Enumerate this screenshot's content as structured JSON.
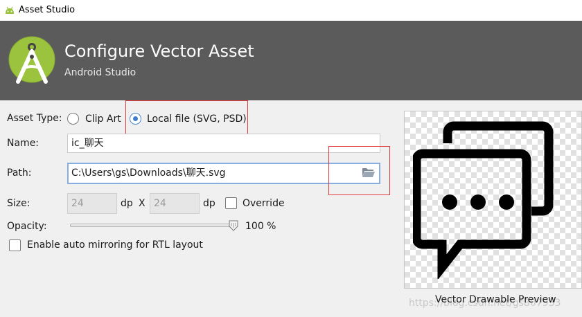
{
  "window": {
    "title": "Asset Studio"
  },
  "header": {
    "title": "Configure Vector Asset",
    "subtitle": "Android Studio"
  },
  "form": {
    "asset_type_label": "Asset Type:",
    "clip_art_label": "Clip Art",
    "local_file_label": "Local file (SVG, PSD)",
    "asset_type_selected": "Local file (SVG, PSD)",
    "name_label": "Name:",
    "name_value": "ic_聊天",
    "path_label": "Path:",
    "path_value": "C:\\Users\\gs\\Downloads\\聊天.svg",
    "size_label": "Size:",
    "width_value": "24",
    "height_value": "24",
    "unit_label": "dp",
    "x_label": "X",
    "override_label": "Override",
    "override_checked": false,
    "opacity_label": "Opacity:",
    "opacity_value": "100 %",
    "opacity_fraction": 1.0,
    "rtl_label": "Enable auto mirroring for RTL layout",
    "rtl_checked": false
  },
  "preview": {
    "caption": "Vector Drawable Preview"
  },
  "watermark": "https://blog.csdn.net/gs807933",
  "colors": {
    "header_bg": "#5b5b5b",
    "android_green": "#9bc33e",
    "annotation_red": "#e13b3b",
    "focus_blue": "#86aee0",
    "radio_blue": "#3c7fd1"
  },
  "icons": [
    "android-icon",
    "android-studio-logo",
    "folder-open-icon",
    "chat-bubbles-icon",
    "slider-thumb-icon"
  ]
}
